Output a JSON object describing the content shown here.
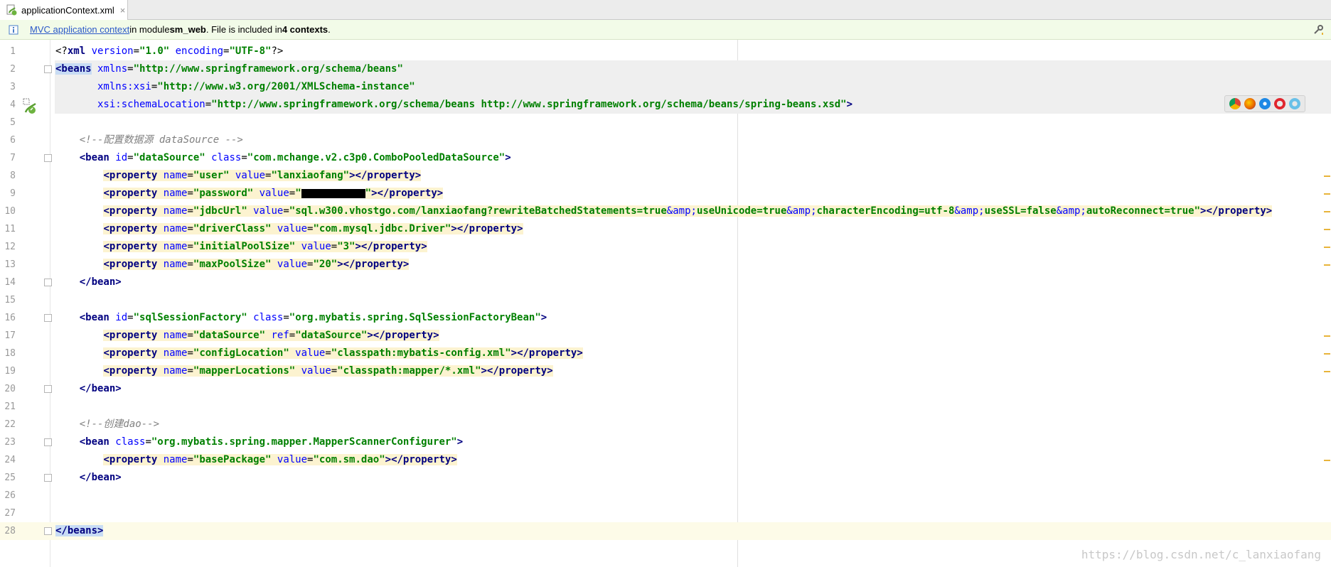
{
  "tab": {
    "title": "applicationContext.xml",
    "close": "×"
  },
  "notification": {
    "link": "MVC application context",
    "text1": " in module ",
    "module": "sm_web",
    "text2": ". File is included in ",
    "count": "4 contexts",
    "text3": "."
  },
  "colors": {
    "tag": "#000080",
    "attr": "#0000ff",
    "value": "#008000",
    "comment": "#808080",
    "line_highlight": "#fcf3d0"
  },
  "lines": [
    {
      "n": "1",
      "tokens": [
        {
          "t": "<?",
          "c": "pl"
        },
        {
          "t": "xml",
          "c": "tag"
        },
        {
          "t": " version",
          "c": "attr"
        },
        {
          "t": "=",
          "c": "pl"
        },
        {
          "t": "\"1.0\"",
          "c": "val"
        },
        {
          "t": " encoding",
          "c": "attr"
        },
        {
          "t": "=",
          "c": "pl"
        },
        {
          "t": "\"UTF-8\"",
          "c": "val"
        },
        {
          "t": "?>",
          "c": "pl"
        }
      ]
    },
    {
      "n": "2",
      "hl": true,
      "tokens": [
        {
          "t": "<beans",
          "c": "tag",
          "sel": true
        },
        {
          "t": " xmlns",
          "c": "attr"
        },
        {
          "t": "=",
          "c": "pl"
        },
        {
          "t": "\"http://www.springframework.org/schema/beans\"",
          "c": "val"
        }
      ]
    },
    {
      "n": "3",
      "hl": true,
      "tokens": [
        {
          "t": "       xmlns:xsi",
          "c": "attr"
        },
        {
          "t": "=",
          "c": "pl"
        },
        {
          "t": "\"http://www.w3.org/2001/XMLSchema-instance\"",
          "c": "val"
        }
      ]
    },
    {
      "n": "4",
      "hl": true,
      "tokens": [
        {
          "t": "       xsi:schemaLocation",
          "c": "attr"
        },
        {
          "t": "=",
          "c": "pl"
        },
        {
          "t": "\"http://www.springframework.org/schema/beans http://www.springframework.org/schema/beans/spring-beans.xsd\"",
          "c": "val"
        },
        {
          "t": ">",
          "c": "tag"
        }
      ]
    },
    {
      "n": "5",
      "tokens": []
    },
    {
      "n": "6",
      "tokens": [
        {
          "t": "    <!--配置数据源 dataSource -->",
          "c": "com"
        }
      ]
    },
    {
      "n": "7",
      "tokens": [
        {
          "t": "    <bean",
          "c": "tag"
        },
        {
          "t": " id",
          "c": "attr"
        },
        {
          "t": "=",
          "c": "pl"
        },
        {
          "t": "\"dataSource\"",
          "c": "val"
        },
        {
          "t": " class",
          "c": "attr"
        },
        {
          "t": "=",
          "c": "pl"
        },
        {
          "t": "\"com.mchange.v2.c3p0.ComboPooledDataSource\"",
          "c": "val"
        },
        {
          "t": ">",
          "c": "tag"
        }
      ]
    },
    {
      "n": "8",
      "tokens": [
        {
          "t": "        ",
          "c": "pl"
        },
        {
          "t": "<property",
          "c": "tag",
          "by": true
        },
        {
          "t": " name",
          "c": "attr",
          "by": true
        },
        {
          "t": "=",
          "c": "pl",
          "by": true
        },
        {
          "t": "\"user\"",
          "c": "val",
          "by": true
        },
        {
          "t": " value",
          "c": "attr",
          "by": true
        },
        {
          "t": "=",
          "c": "pl",
          "by": true
        },
        {
          "t": "\"lanxiaofang\"",
          "c": "val",
          "by": true
        },
        {
          "t": "></property>",
          "c": "tag",
          "by": true
        }
      ]
    },
    {
      "n": "9",
      "tokens": [
        {
          "t": "        ",
          "c": "pl"
        },
        {
          "t": "<property",
          "c": "tag",
          "by": true
        },
        {
          "t": " name",
          "c": "attr",
          "by": true
        },
        {
          "t": "=",
          "c": "pl",
          "by": true
        },
        {
          "t": "\"password\"",
          "c": "val",
          "by": true
        },
        {
          "t": " value",
          "c": "attr",
          "by": true
        },
        {
          "t": "=",
          "c": "pl",
          "by": true
        },
        {
          "t": "\"",
          "c": "val",
          "by": true
        },
        {
          "t": "",
          "c": "redact",
          "by": true
        },
        {
          "t": "\"",
          "c": "val",
          "by": true
        },
        {
          "t": "></property>",
          "c": "tag",
          "by": true
        }
      ]
    },
    {
      "n": "10",
      "tokens": [
        {
          "t": "        ",
          "c": "pl"
        },
        {
          "t": "<property",
          "c": "tag",
          "by": true
        },
        {
          "t": " name",
          "c": "attr",
          "by": true
        },
        {
          "t": "=",
          "c": "pl",
          "by": true
        },
        {
          "t": "\"jdbcUrl\"",
          "c": "val",
          "by": true
        },
        {
          "t": " value",
          "c": "attr",
          "by": true
        },
        {
          "t": "=",
          "c": "pl",
          "by": true
        },
        {
          "t": "\"sql.w300.vhostgo.com/lanxiaofang?rewriteBatchedStatements=true",
          "c": "val",
          "by": true
        },
        {
          "t": "&amp;",
          "c": "attr",
          "by": true
        },
        {
          "t": "useUnicode=true",
          "c": "val",
          "by": true
        },
        {
          "t": "&amp;",
          "c": "attr",
          "by": true
        },
        {
          "t": "characterEncoding=utf-8",
          "c": "val",
          "by": true
        },
        {
          "t": "&amp;",
          "c": "attr",
          "by": true
        },
        {
          "t": "useSSL=false",
          "c": "val",
          "by": true
        },
        {
          "t": "&amp;",
          "c": "attr",
          "by": true
        },
        {
          "t": "autoReconnect=true\"",
          "c": "val",
          "by": true
        },
        {
          "t": "></property>",
          "c": "tag",
          "by": true
        }
      ]
    },
    {
      "n": "11",
      "tokens": [
        {
          "t": "        ",
          "c": "pl"
        },
        {
          "t": "<property",
          "c": "tag",
          "by": true
        },
        {
          "t": " name",
          "c": "attr",
          "by": true
        },
        {
          "t": "=",
          "c": "pl",
          "by": true
        },
        {
          "t": "\"driverClass\"",
          "c": "val",
          "by": true
        },
        {
          "t": " value",
          "c": "attr",
          "by": true
        },
        {
          "t": "=",
          "c": "pl",
          "by": true
        },
        {
          "t": "\"com.mysql.jdbc.Driver\"",
          "c": "val",
          "by": true
        },
        {
          "t": "></property>",
          "c": "tag",
          "by": true
        }
      ]
    },
    {
      "n": "12",
      "tokens": [
        {
          "t": "        ",
          "c": "pl"
        },
        {
          "t": "<property",
          "c": "tag",
          "by": true
        },
        {
          "t": " name",
          "c": "attr",
          "by": true
        },
        {
          "t": "=",
          "c": "pl",
          "by": true
        },
        {
          "t": "\"initialPoolSize\"",
          "c": "val",
          "by": true
        },
        {
          "t": " value",
          "c": "attr",
          "by": true
        },
        {
          "t": "=",
          "c": "pl",
          "by": true
        },
        {
          "t": "\"3\"",
          "c": "val",
          "by": true
        },
        {
          "t": "></property>",
          "c": "tag",
          "by": true
        }
      ]
    },
    {
      "n": "13",
      "tokens": [
        {
          "t": "        ",
          "c": "pl"
        },
        {
          "t": "<property",
          "c": "tag",
          "by": true
        },
        {
          "t": " name",
          "c": "attr",
          "by": true
        },
        {
          "t": "=",
          "c": "pl",
          "by": true
        },
        {
          "t": "\"maxPoolSize\"",
          "c": "val",
          "by": true
        },
        {
          "t": " value",
          "c": "attr",
          "by": true
        },
        {
          "t": "=",
          "c": "pl",
          "by": true
        },
        {
          "t": "\"20\"",
          "c": "val",
          "by": true
        },
        {
          "t": "></property>",
          "c": "tag",
          "by": true
        }
      ]
    },
    {
      "n": "14",
      "tokens": [
        {
          "t": "    </bean>",
          "c": "tag"
        }
      ]
    },
    {
      "n": "15",
      "tokens": []
    },
    {
      "n": "16",
      "tokens": [
        {
          "t": "    <bean",
          "c": "tag"
        },
        {
          "t": " id",
          "c": "attr"
        },
        {
          "t": "=",
          "c": "pl"
        },
        {
          "t": "\"sqlSessionFactory\"",
          "c": "val"
        },
        {
          "t": " class",
          "c": "attr"
        },
        {
          "t": "=",
          "c": "pl"
        },
        {
          "t": "\"org.mybatis.spring.SqlSessionFactoryBean\"",
          "c": "val"
        },
        {
          "t": ">",
          "c": "tag"
        }
      ]
    },
    {
      "n": "17",
      "tokens": [
        {
          "t": "        ",
          "c": "pl"
        },
        {
          "t": "<property",
          "c": "tag",
          "by": true
        },
        {
          "t": " name",
          "c": "attr",
          "by": true
        },
        {
          "t": "=",
          "c": "pl",
          "by": true
        },
        {
          "t": "\"dataSource\"",
          "c": "val",
          "by": true
        },
        {
          "t": " ref",
          "c": "attr",
          "by": true
        },
        {
          "t": "=",
          "c": "pl",
          "by": true
        },
        {
          "t": "\"dataSource\"",
          "c": "val",
          "by": true
        },
        {
          "t": "></property>",
          "c": "tag",
          "by": true
        }
      ]
    },
    {
      "n": "18",
      "tokens": [
        {
          "t": "        ",
          "c": "pl"
        },
        {
          "t": "<property",
          "c": "tag",
          "by": true
        },
        {
          "t": " name",
          "c": "attr",
          "by": true
        },
        {
          "t": "=",
          "c": "pl",
          "by": true
        },
        {
          "t": "\"configLocation\"",
          "c": "val",
          "by": true
        },
        {
          "t": " value",
          "c": "attr",
          "by": true
        },
        {
          "t": "=",
          "c": "pl",
          "by": true
        },
        {
          "t": "\"classpath:mybatis-config.xml\"",
          "c": "val",
          "by": true
        },
        {
          "t": "></property>",
          "c": "tag",
          "by": true
        }
      ]
    },
    {
      "n": "19",
      "tokens": [
        {
          "t": "        ",
          "c": "pl"
        },
        {
          "t": "<property",
          "c": "tag",
          "by": true
        },
        {
          "t": " name",
          "c": "attr",
          "by": true
        },
        {
          "t": "=",
          "c": "pl",
          "by": true
        },
        {
          "t": "\"mapperLocations\"",
          "c": "val",
          "by": true
        },
        {
          "t": " value",
          "c": "attr",
          "by": true
        },
        {
          "t": "=",
          "c": "pl",
          "by": true
        },
        {
          "t": "\"classpath:mapper/*.xml\"",
          "c": "val",
          "by": true
        },
        {
          "t": "></property>",
          "c": "tag",
          "by": true
        }
      ]
    },
    {
      "n": "20",
      "tokens": [
        {
          "t": "    </bean>",
          "c": "tag"
        }
      ]
    },
    {
      "n": "21",
      "tokens": []
    },
    {
      "n": "22",
      "tokens": [
        {
          "t": "    <!--创建dao-->",
          "c": "com"
        }
      ]
    },
    {
      "n": "23",
      "tokens": [
        {
          "t": "    <bean",
          "c": "tag"
        },
        {
          "t": " class",
          "c": "attr"
        },
        {
          "t": "=",
          "c": "pl"
        },
        {
          "t": "\"org.mybatis.spring.mapper.MapperScannerConfigurer\"",
          "c": "val"
        },
        {
          "t": ">",
          "c": "tag"
        }
      ]
    },
    {
      "n": "24",
      "tokens": [
        {
          "t": "        ",
          "c": "pl"
        },
        {
          "t": "<property",
          "c": "tag",
          "by": true
        },
        {
          "t": " name",
          "c": "attr",
          "by": true
        },
        {
          "t": "=",
          "c": "pl",
          "by": true
        },
        {
          "t": "\"basePackage\"",
          "c": "val",
          "by": true
        },
        {
          "t": " value",
          "c": "attr",
          "by": true
        },
        {
          "t": "=",
          "c": "pl",
          "by": true
        },
        {
          "t": "\"com.sm.dao\"",
          "c": "val",
          "by": true
        },
        {
          "t": "></property>",
          "c": "tag",
          "by": true
        }
      ]
    },
    {
      "n": "25",
      "tokens": [
        {
          "t": "    </bean>",
          "c": "tag"
        }
      ]
    },
    {
      "n": "26",
      "tokens": []
    },
    {
      "n": "27",
      "tokens": []
    },
    {
      "n": "28",
      "current": true,
      "tokens": [
        {
          "t": "</beans>",
          "c": "tag",
          "sel": true
        }
      ]
    }
  ],
  "browser_icons": [
    "chrome-icon",
    "firefox-icon",
    "safari-icon",
    "opera-icon",
    "ie-icon"
  ],
  "watermark": "https://blog.csdn.net/c_lanxiaofang"
}
